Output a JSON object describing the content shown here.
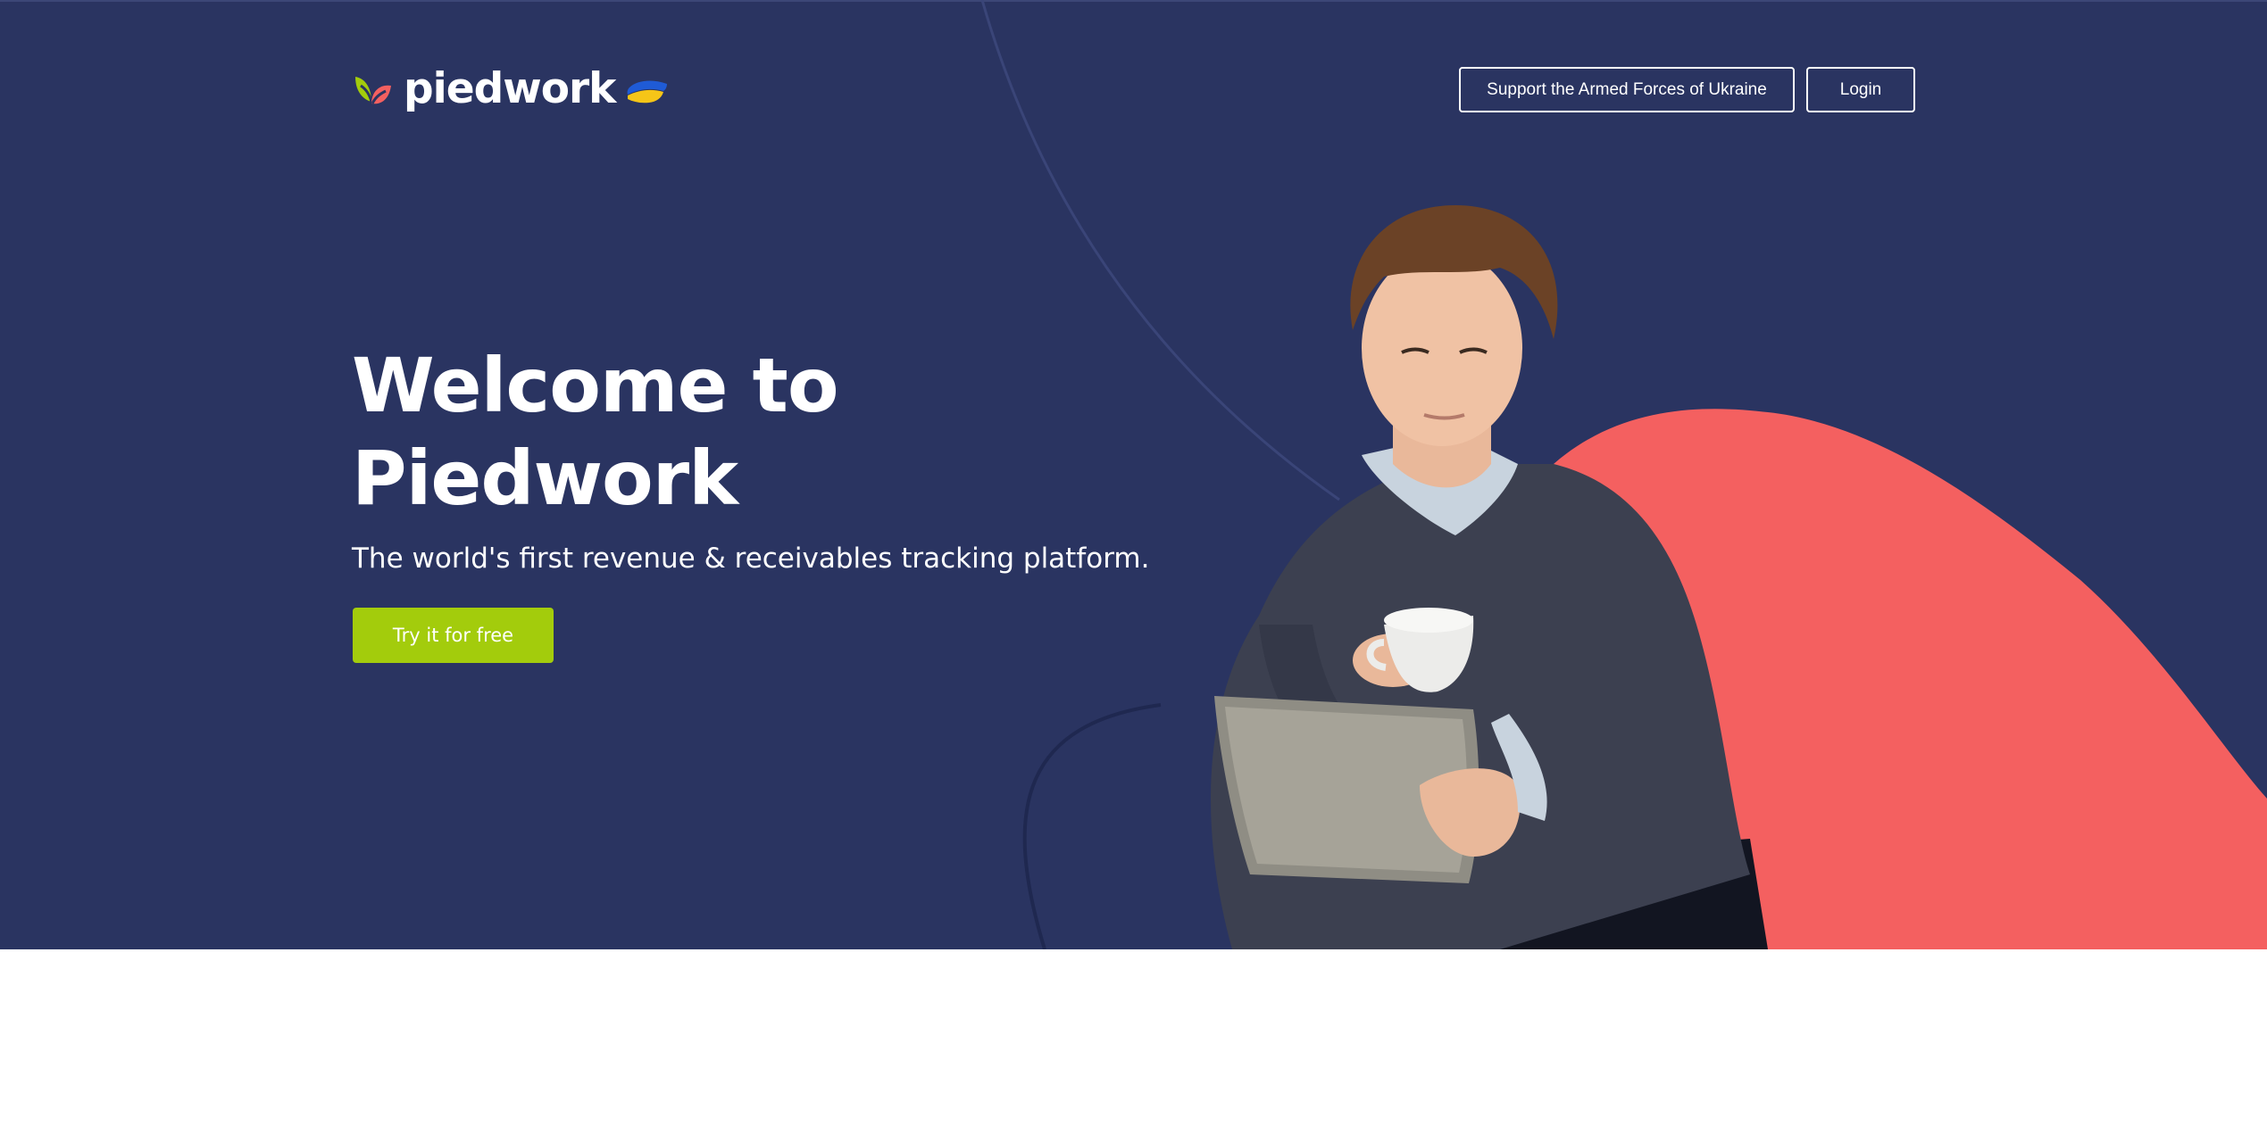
{
  "brand": {
    "name": "piedwork",
    "logo_icon": "leaf-logo-icon",
    "flag_icon": "ukraine-flag-icon",
    "colors": {
      "leaf_green": "#a3cc0c",
      "leaf_red": "#f46060",
      "flag_blue": "#1f5bd6",
      "flag_yellow": "#f5c518"
    }
  },
  "header": {
    "support_label": "Support the Armed Forces of Ukraine",
    "login_label": "Login"
  },
  "hero": {
    "title_line1": "Welcome to",
    "title_line2": "Piedwork",
    "subtitle": "The world's first revenue & receivables tracking platform.",
    "cta_label": "Try it for free",
    "image": "man-with-tablet-and-coffee-illustration"
  },
  "colors": {
    "background": "#2a3461",
    "accent_coral": "#f46060",
    "cta_green": "#a3cc0c",
    "text": "#ffffff",
    "page_bottom": "#ffffff"
  }
}
